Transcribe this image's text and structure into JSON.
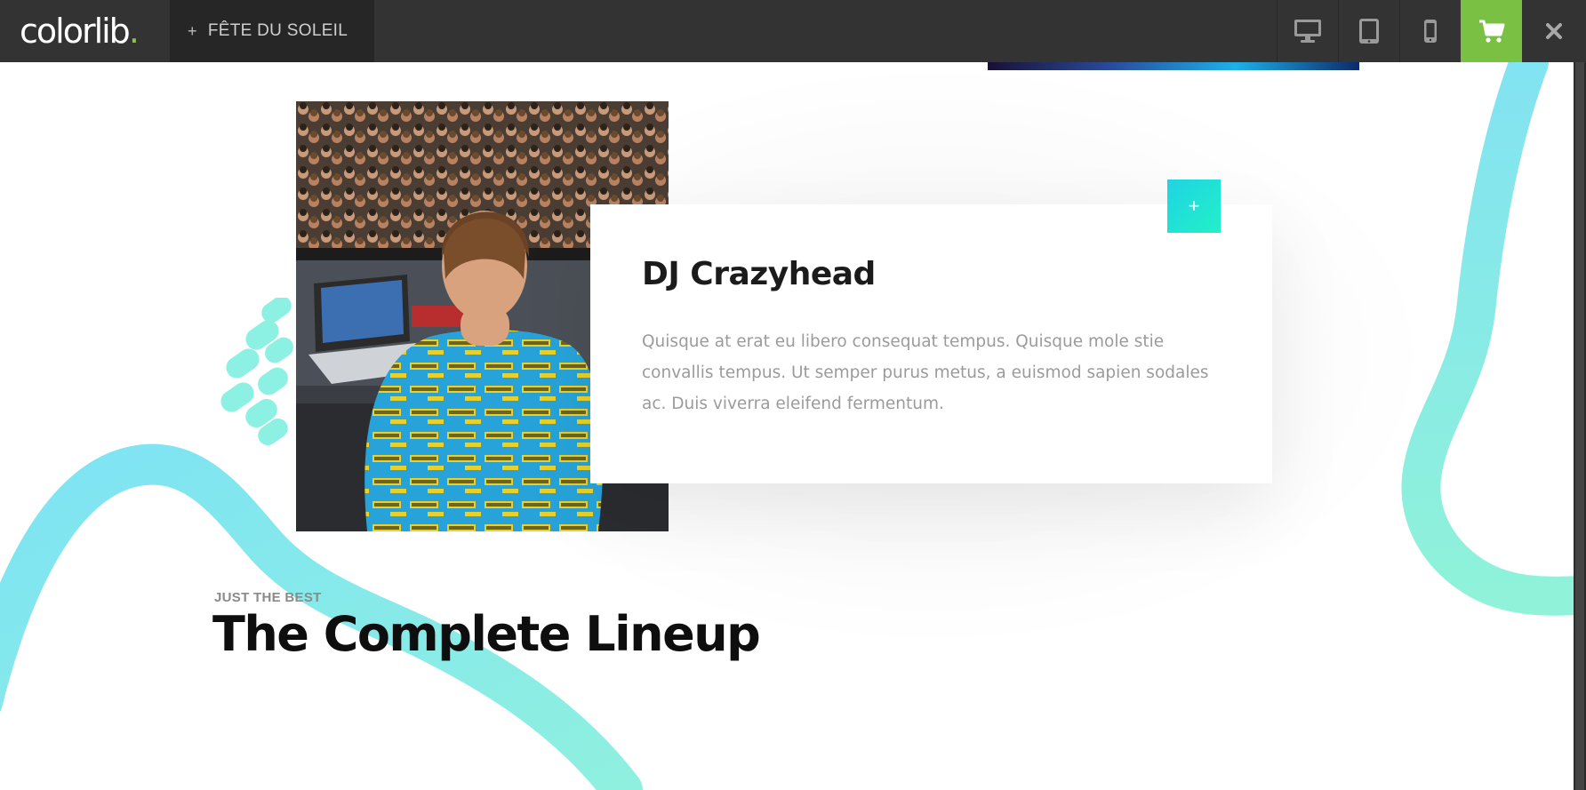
{
  "brand": {
    "logo_text": "colorlib",
    "logo_dot": "."
  },
  "topbar": {
    "theme_label": "FÊTE DU SOLEIL",
    "buttons": [
      "desktop-icon",
      "tablet-icon",
      "mobile-icon",
      "cart-icon",
      "close-icon"
    ],
    "colors": {
      "bar": "#333333",
      "cart": "#7ac143"
    }
  },
  "artist": {
    "name": "DJ Crazyhead",
    "description": "Quisque at erat eu libero consequat tempus. Quisque mole stie convallis tempus. Ut semper purus metus, a euismod sapien sodales ac. Duis viverra eleifend fermentum.",
    "more_symbol": "+"
  },
  "lineup": {
    "eyebrow": "JUST THE BEST",
    "heading": "The Complete Lineup"
  },
  "colors": {
    "accent_start": "#1fd4e4",
    "accent_end": "#23f0c7"
  }
}
